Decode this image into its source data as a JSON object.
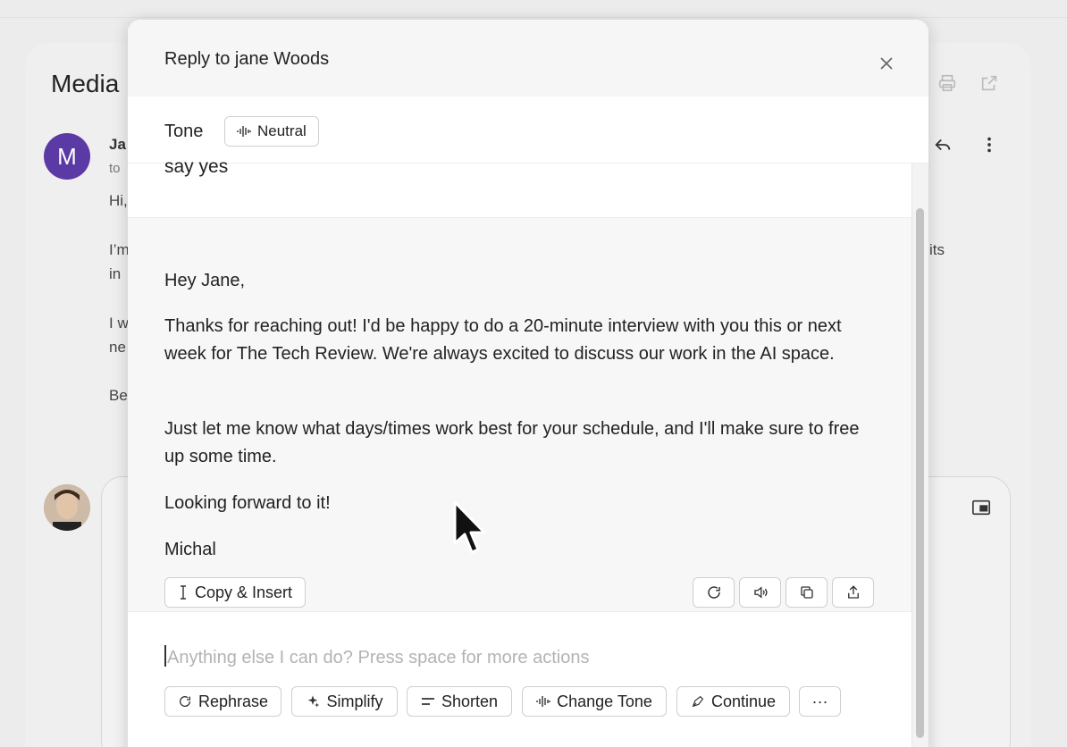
{
  "background": {
    "subject": "Media",
    "sender_initial": "M",
    "sender_name": "Ja",
    "sender_to": "to",
    "body_fragments": [
      "Hi,",
      "I’m",
      "in",
      "I w",
      "ne",
      "Be"
    ],
    "right_fragment": "its"
  },
  "dialog": {
    "title": "Reply to jane Woods",
    "tone_label": "Tone",
    "tone_value": "Neutral",
    "prompt_text": "say yes",
    "response": {
      "greeting": "Hey Jane,",
      "para1": "Thanks for reaching out! I'd be happy to do a 20-minute interview with you this or next week for The Tech Review. We're always excited to discuss our work in the AI space.",
      "para2": "Just let me know what days/times work best for your schedule, and I'll make sure to free up some time.",
      "closing": "Looking forward to it!",
      "signature": "Michal"
    },
    "copy_insert_label": "Copy & Insert",
    "input_placeholder": "Anything else I can do? Press space for more actions",
    "actions": {
      "rephrase": "Rephrase",
      "simplify": "Simplify",
      "shorten": "Shorten",
      "change_tone": "Change Tone",
      "continue": "Continue",
      "more": "···"
    }
  },
  "colors": {
    "avatar_purple": "#5b3aa6",
    "response_bg": "#f7f7f7"
  }
}
